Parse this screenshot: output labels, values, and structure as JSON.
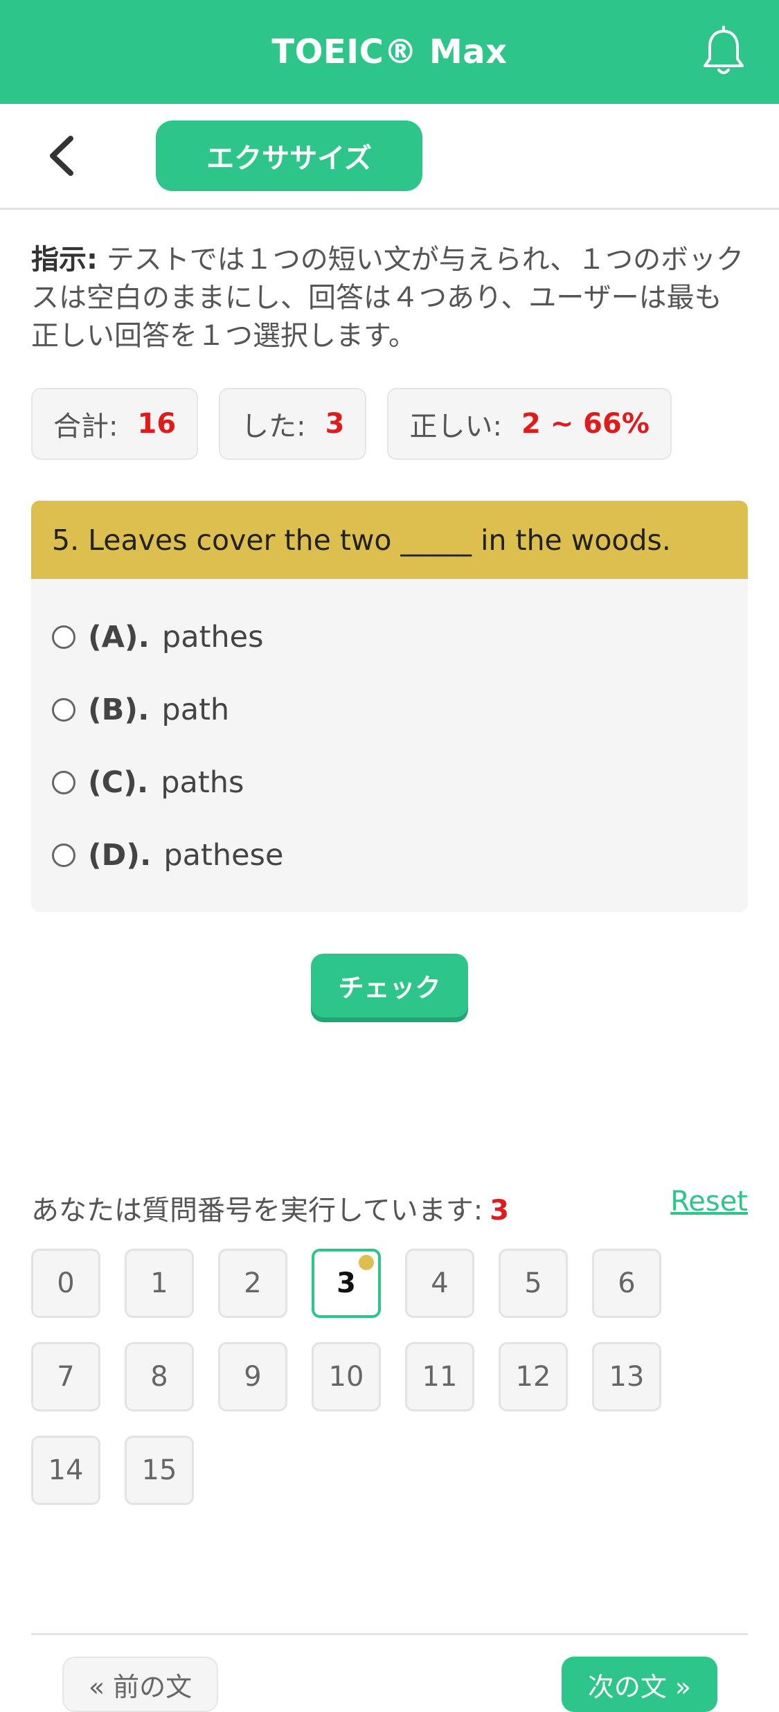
{
  "app": {
    "title": "TOEIC® Max",
    "accent": "#2ec58a",
    "question_color": "#dcbf4f",
    "value_color": "#e01b1b"
  },
  "header": {
    "notification_icon": "bell-icon",
    "back_icon": "chevron-left-icon",
    "section_label": "エクササイズ"
  },
  "instructions": {
    "label": "指示:",
    "text": "テストでは１つの短い文が与えられ、１つのボックスは空白のままにし、回答は４つあり、ユーザーは最も正しい回答を１つ選択します。"
  },
  "stats": [
    {
      "label": "合計:",
      "value": "16"
    },
    {
      "label": "した:",
      "value": "3"
    },
    {
      "label": "正しい:",
      "value": "2 ~ 66%"
    }
  ],
  "question": {
    "text": "5. Leaves cover the two _____ in the woods.",
    "options": [
      {
        "letter": "(A).",
        "text": "pathes"
      },
      {
        "letter": "(B).",
        "text": "path"
      },
      {
        "letter": "(C).",
        "text": "paths"
      },
      {
        "letter": "(D).",
        "text": "pathese"
      }
    ]
  },
  "check_label": "チェック",
  "progress": {
    "label": "あなたは質問番号を実行しています:",
    "current": "3",
    "reset_label": "Reset"
  },
  "numbers": [
    "0",
    "1",
    "2",
    "3",
    "4",
    "5",
    "6",
    "7",
    "8",
    "9",
    "10",
    "11",
    "12",
    "13",
    "14",
    "15"
  ],
  "active_number": 3,
  "nav": {
    "prev_label": "« 前の文",
    "next_label": "次の文 »"
  }
}
